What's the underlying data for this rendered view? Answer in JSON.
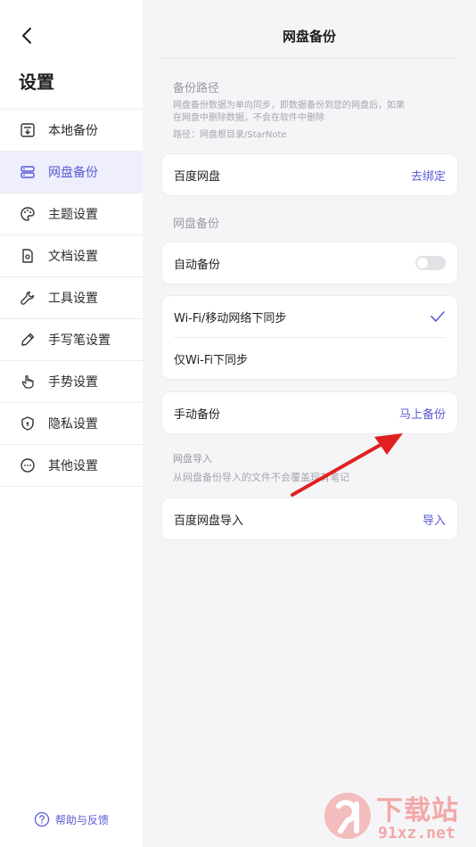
{
  "sidebar": {
    "title": "设置",
    "items": [
      {
        "label": "本地备份",
        "icon": "local-backup-icon"
      },
      {
        "label": "网盘备份",
        "icon": "cloud-backup-icon"
      },
      {
        "label": "主题设置",
        "icon": "palette-icon"
      },
      {
        "label": "文档设置",
        "icon": "document-settings-icon"
      },
      {
        "label": "工具设置",
        "icon": "wrench-icon"
      },
      {
        "label": "手写笔设置",
        "icon": "pen-icon"
      },
      {
        "label": "手势设置",
        "icon": "hand-gesture-icon"
      },
      {
        "label": "隐私设置",
        "icon": "shield-icon"
      },
      {
        "label": "其他设置",
        "icon": "more-circle-icon"
      }
    ],
    "active_index": 1,
    "help_label": "帮助与反馈"
  },
  "main": {
    "title": "网盘备份",
    "backup_path": {
      "label": "备份路径",
      "desc_line1": "网盘备份数据为单向同步，即数据备份到您的网盘后，如果",
      "desc_line2": "在网盘中删除数据，不会在软件中删除",
      "path": "路径：网盘根目录/StarNote"
    },
    "baidu_pan": {
      "label": "百度网盘",
      "action": "去绑定"
    },
    "cloud_backup": {
      "label": "网盘备份",
      "auto_backup_label": "自动备份",
      "auto_backup_on": false
    },
    "sync_options": [
      {
        "label": "Wi-Fi/移动网络下同步",
        "selected": true
      },
      {
        "label": "仅Wi-Fi下同步",
        "selected": false
      }
    ],
    "manual_backup": {
      "label": "手动备份",
      "action": "马上备份"
    },
    "cloud_import": {
      "label": "网盘导入",
      "desc": "从网盘备份导入的文件不会覆盖现有笔记",
      "baidu_import_label": "百度网盘导入",
      "action": "导入"
    }
  },
  "watermark": {
    "text_top": "下载站",
    "text_bottom": "91xz.net"
  },
  "colors": {
    "accent": "#5b5bd6",
    "active_bg": "#eeeefc",
    "arrow": "#e02020"
  }
}
